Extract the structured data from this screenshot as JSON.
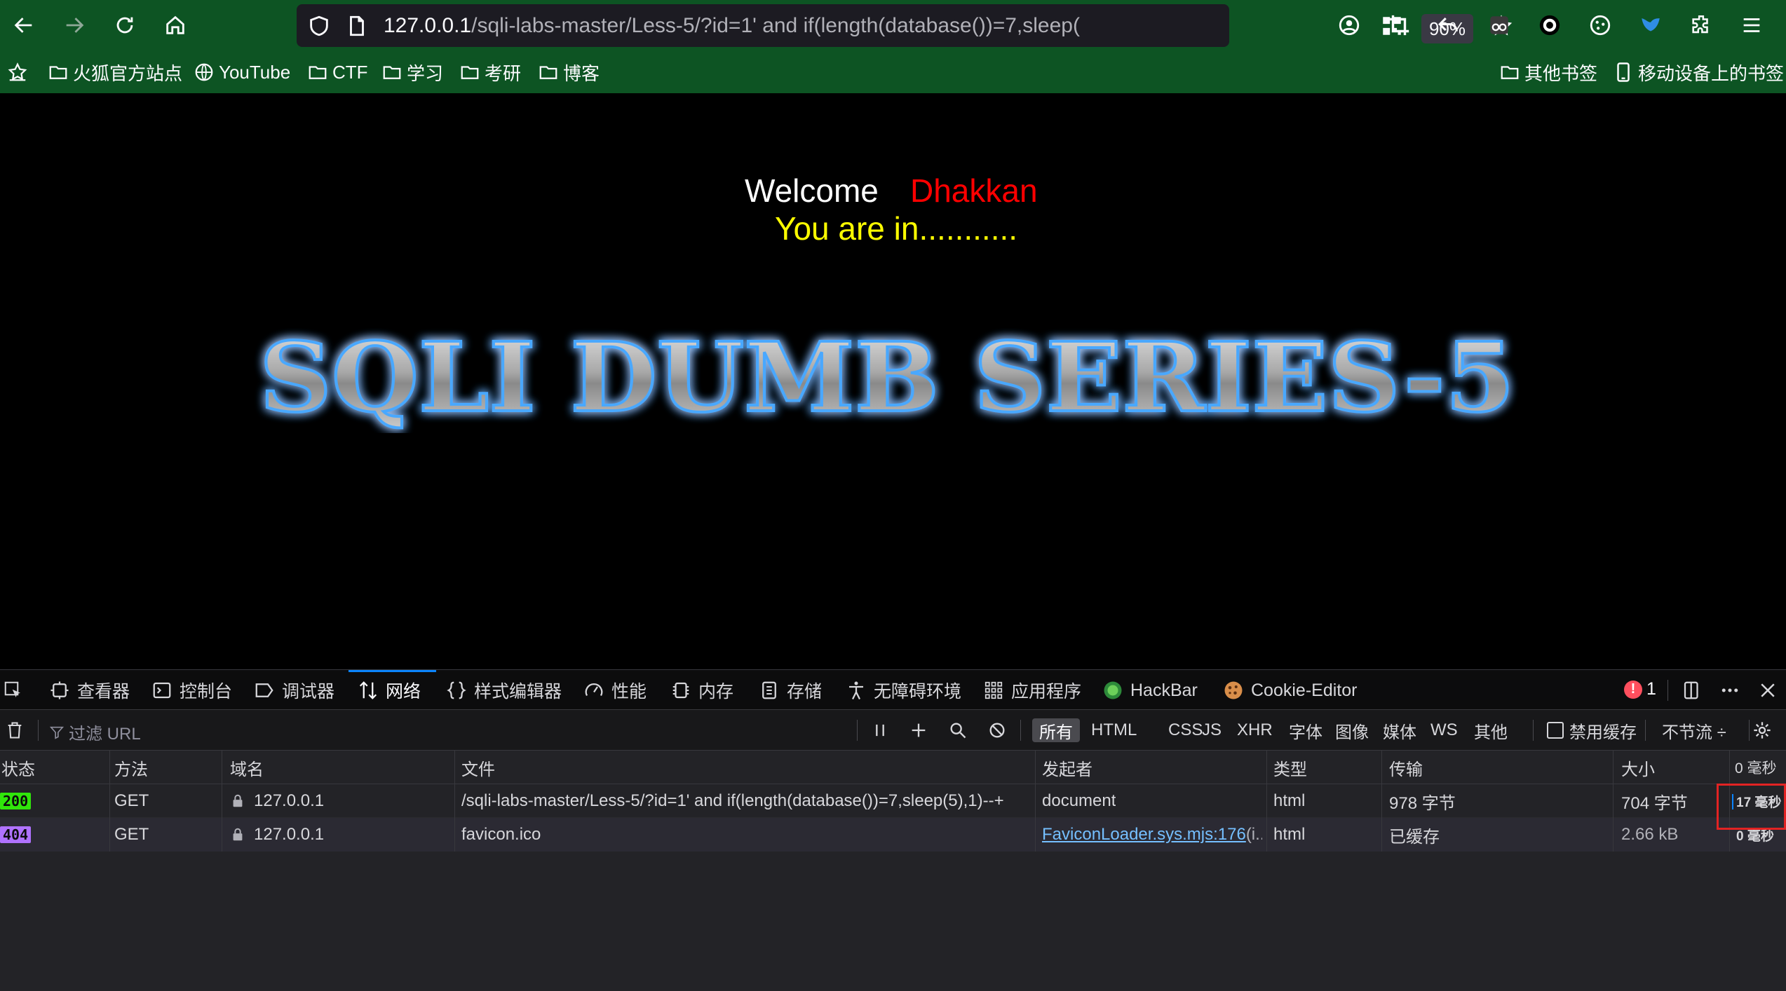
{
  "browser": {
    "url_host": "127.0.0.1",
    "url_path": "/sqli-labs-master/Less-5/?id=1' and if(length(database())=7,sleep(",
    "zoom": "90%"
  },
  "bookmarks": {
    "items": [
      "火狐官方站点",
      "YouTube",
      "CTF",
      "学习",
      "考研",
      "博客"
    ],
    "other": "其他书签",
    "mobile": "移动设备上的书签"
  },
  "page": {
    "welcome": "Welcome",
    "name": "Dhakkan",
    "status": "You are in...........",
    "logo_text": "SQLI DUMB SERIES-5"
  },
  "devtools": {
    "tabs": [
      "查看器",
      "控制台",
      "调试器",
      "网络",
      "样式编辑器",
      "性能",
      "内存",
      "存储",
      "无障碍环境",
      "应用程序",
      "HackBar",
      "Cookie-Editor"
    ],
    "active_tab": "网络",
    "error_count": "1",
    "filter_placeholder": "过滤 URL",
    "filters": [
      "所有",
      "HTML",
      "CSS",
      "JS",
      "XHR",
      "字体",
      "图像",
      "媒体",
      "WS",
      "其他"
    ],
    "disable_cache": "禁用缓存",
    "throttle": "不节流 ÷",
    "columns": [
      "状态",
      "方法",
      "域名",
      "文件",
      "发起者",
      "类型",
      "传输",
      "大小",
      "0 毫秒"
    ],
    "requests": [
      {
        "status": "200",
        "method": "GET",
        "domain": "127.0.0.1",
        "file": "/sqli-labs-master/Less-5/?id=1' and if(length(database())=7,sleep(5),1)--+",
        "initiator": "document",
        "type": "html",
        "transferred": "978 字节",
        "size": "704 字节",
        "time": "17 毫秒"
      },
      {
        "status": "404",
        "method": "GET",
        "domain": "127.0.0.1",
        "file": "favicon.ico",
        "initiator": "FaviconLoader.sys.mjs:176",
        "initiator_suffix": " (i...",
        "type": "html",
        "transferred": "已缓存",
        "size": "2.66 kB",
        "time": "0 毫秒"
      }
    ]
  },
  "colors": {
    "toolbar": "#0d5423",
    "welcome_name": "#ff0000",
    "status_text": "#ffff00",
    "logo_glow": "#1e90ff",
    "status_200": "#30e60b",
    "status_404": "#b072ff",
    "highlight": "#e22323"
  }
}
